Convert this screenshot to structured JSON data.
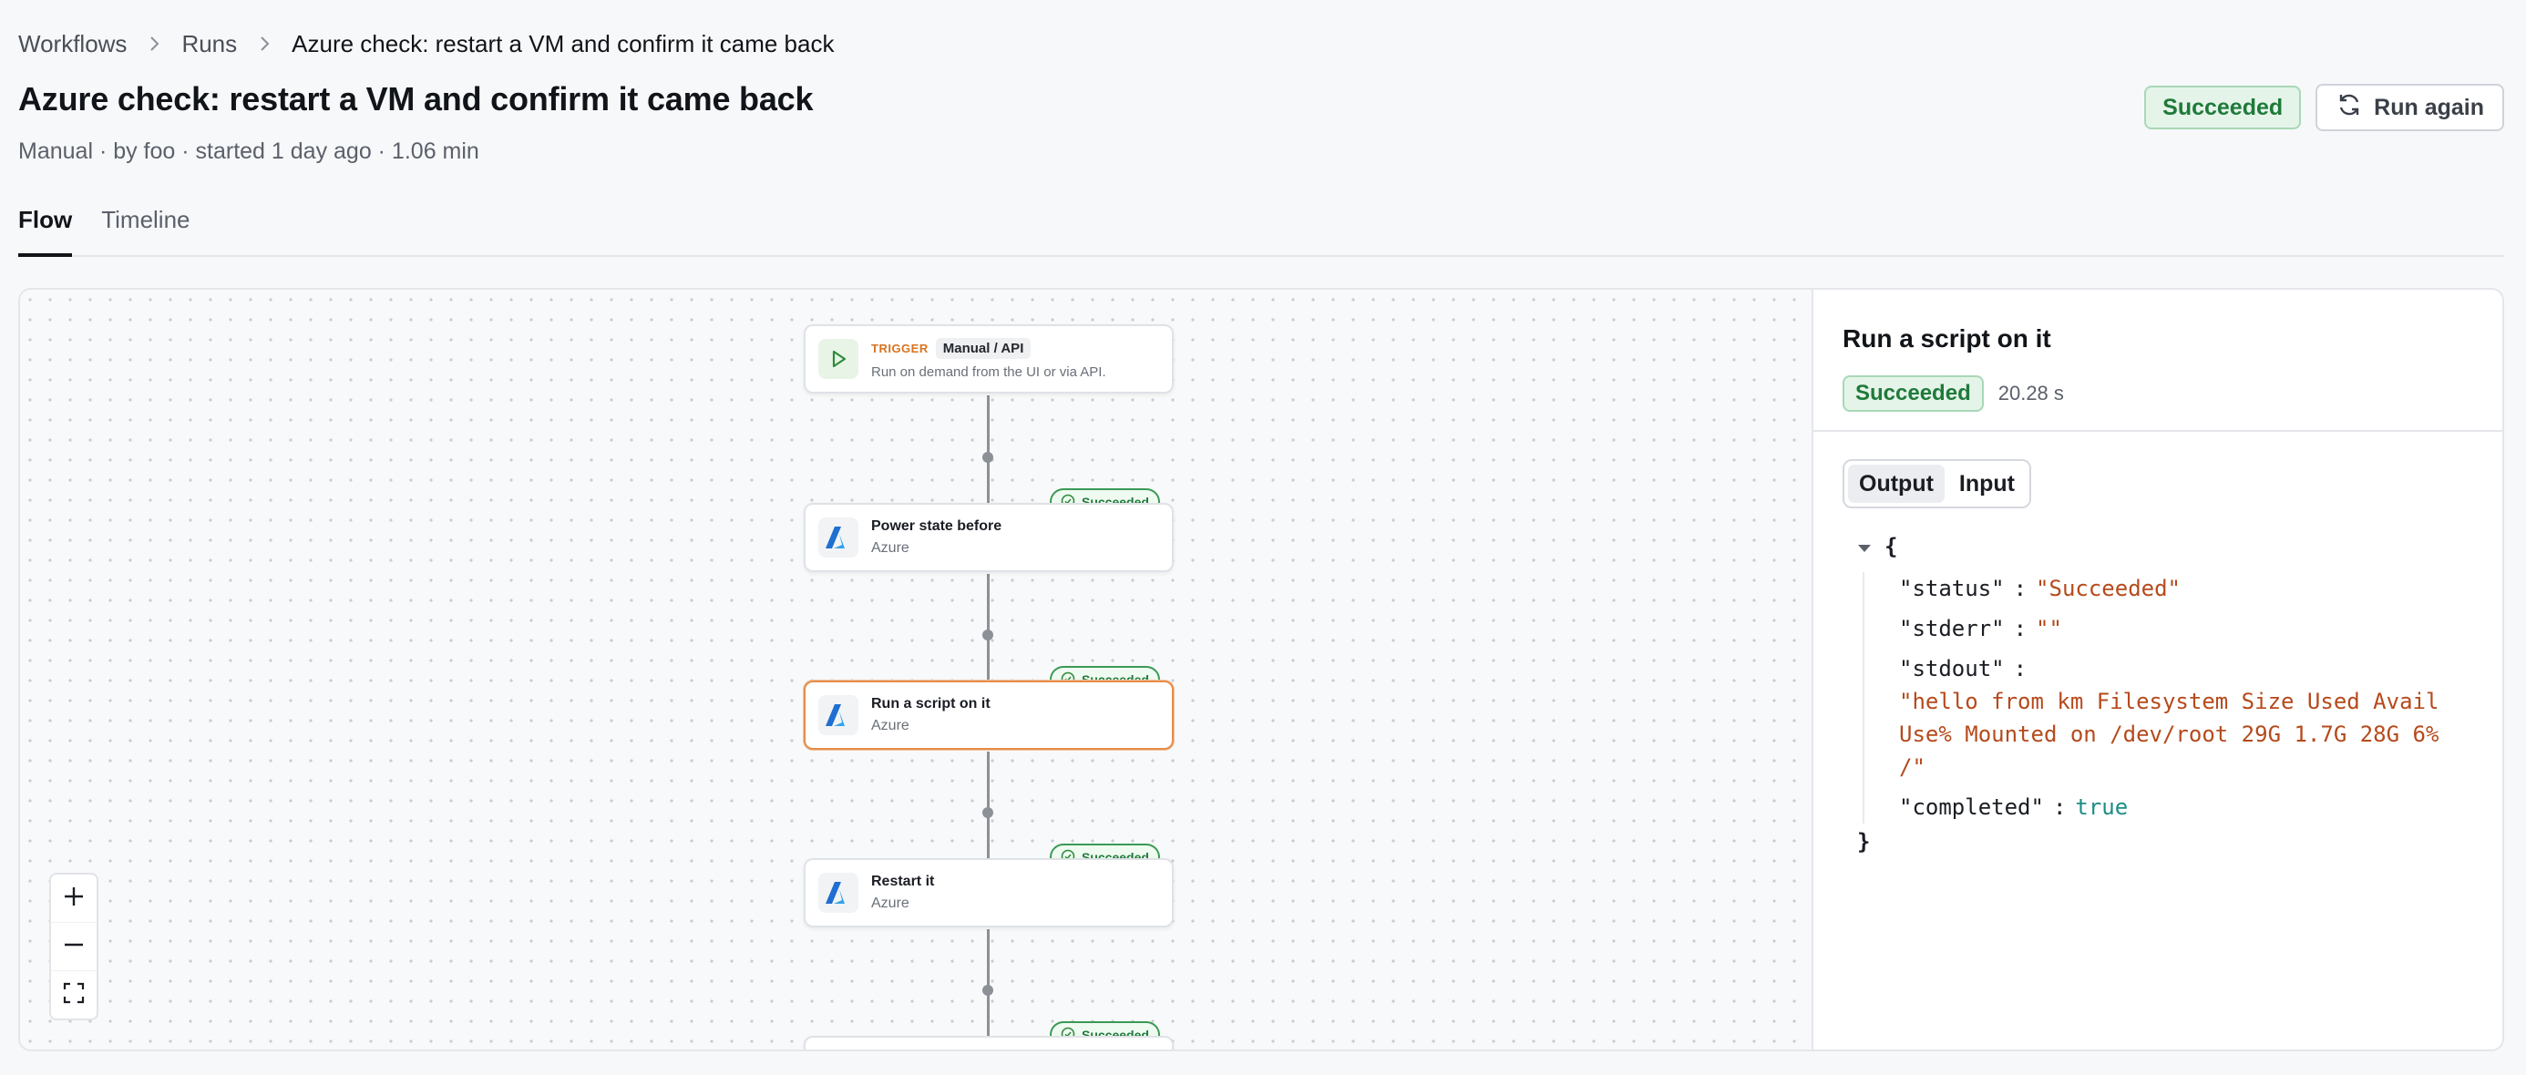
{
  "breadcrumb": {
    "workflows": "Workflows",
    "runs": "Runs",
    "current": "Azure check: restart a VM and confirm it came back"
  },
  "header": {
    "title": "Azure check: restart a VM and confirm it came back",
    "meta": "Manual · by foo · started 1 day ago · 1.06 min",
    "status": "Succeeded",
    "run_again": "Run again"
  },
  "tabs": [
    "Flow",
    "Timeline"
  ],
  "flow": {
    "trigger": {
      "tag": "TRIGGER",
      "chip": "Manual / API",
      "description": "Run on demand from the UI or via API."
    },
    "nodes": [
      {
        "title": "Power state before",
        "subtitle": "Azure",
        "status": "Succeeded"
      },
      {
        "title": "Run a script on it",
        "subtitle": "Azure",
        "status": "Succeeded"
      },
      {
        "title": "Restart it",
        "subtitle": "Azure",
        "status": "Succeeded"
      },
      {
        "status": "Succeeded"
      }
    ]
  },
  "detail": {
    "title": "Run a script on it",
    "status": "Succeeded",
    "duration": "20.28 s",
    "tabs": {
      "output": "Output",
      "input": "Input"
    },
    "json": {
      "open": "{",
      "close": "}",
      "status_key": "\"status\"",
      "status_val": "\"Succeeded\"",
      "stderr_key": "\"stderr\"",
      "stderr_val": "\"\"",
      "stdout_key": "\"stdout\"",
      "stdout_val": "\"hello from km Filesystem Size Used Avail Use% Mounted on /dev/root 29G 1.7G 28G 6% /\"",
      "completed_key": "\"completed\"",
      "completed_val": "true"
    }
  },
  "colors": {
    "success": "#1f7a3a",
    "selected_border": "#e58c4a",
    "trigger_accent": "#d9731e",
    "json_string": "#b54a1c",
    "json_bool": "#1e8d86"
  },
  "icons": [
    "chevron-right-icon",
    "refresh-icon",
    "play-icon",
    "azure-icon",
    "check-circle-icon",
    "plus-icon",
    "minus-icon",
    "fit-view-icon",
    "caret-down-icon"
  ]
}
